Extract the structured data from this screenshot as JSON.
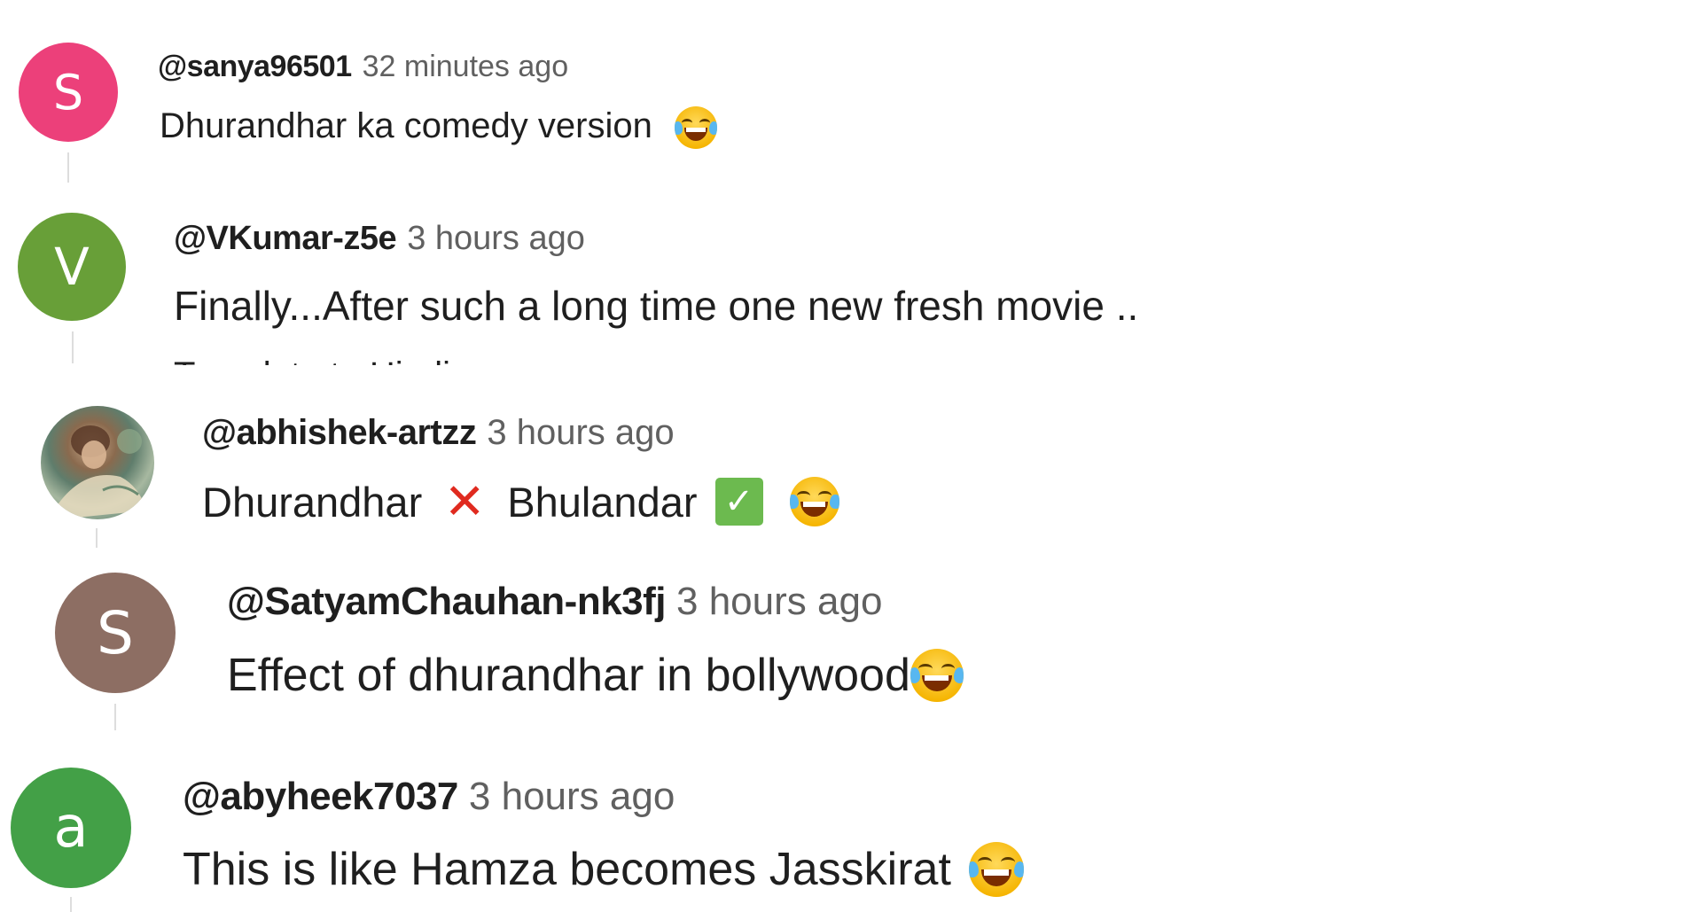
{
  "comments": [
    {
      "avatar_letter": "S",
      "avatar_color": "#ec407a",
      "author": "@sanya96501",
      "time": "32 minutes ago",
      "text": "Dhurandhar ka comedy version"
    },
    {
      "avatar_letter": "V",
      "avatar_color": "#689f38",
      "author": "@VKumar-z5e",
      "time": "3 hours ago",
      "text": "Finally...After such a long time one new fresh movie ..",
      "overflow_text": "Translate to Hindi"
    },
    {
      "avatar_letter": "",
      "avatar_color": "#6d8a7a",
      "author": "@abhishek-artzz",
      "time": "3 hours ago",
      "text_part1": "Dhurandhar",
      "text_part2": "Bhulandar"
    },
    {
      "avatar_letter": "S",
      "avatar_color": "#8d6e63",
      "author": "@SatyamChauhan-nk3fj",
      "time": "3 hours ago",
      "text": "Effect of dhurandhar in bollywood"
    },
    {
      "avatar_letter": "a",
      "avatar_color": "#43a047",
      "author": "@abyheek7037",
      "time": "3 hours ago",
      "text": "This is like Hamza becomes Jasskirat"
    }
  ],
  "icons": {
    "laugh": "face-with-tears-of-joy-emoji",
    "cross": "cross-mark-emoji",
    "check": "check-mark-button-emoji",
    "photo_avatar": "photo-avatar"
  }
}
